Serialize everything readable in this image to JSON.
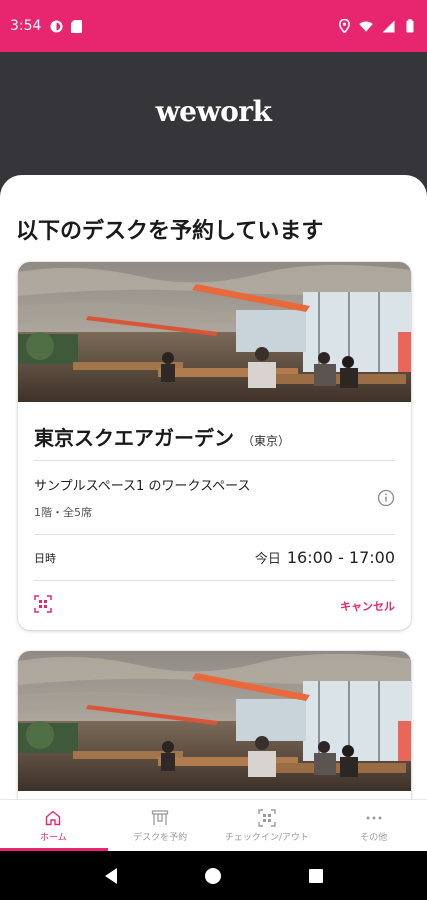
{
  "status_bar": {
    "time": "3:54"
  },
  "header": {
    "logo_text": "wework"
  },
  "main": {
    "section_title": "以下のデスクを予約しています",
    "bookings": [
      {
        "location_name": "東京スクエアガーデン",
        "city": "（東京）",
        "space_name": "サンプルスペース1 のワークスペース",
        "space_detail": "1階・全5席",
        "datetime_label": "日時",
        "day": "今日",
        "time_range": "16:00 - 17:00",
        "cancel_label": "キャンセル"
      },
      {
        "location_name": "",
        "city": ""
      }
    ]
  },
  "bottom_nav": {
    "tabs": [
      {
        "label": "ホーム",
        "icon": "home-icon",
        "active": true
      },
      {
        "label": "デスクを予約",
        "icon": "desk-icon",
        "active": false
      },
      {
        "label": "チェックイン/アウト",
        "icon": "qr-scan-icon",
        "active": false
      },
      {
        "label": "その他",
        "icon": "more-icon",
        "active": false
      }
    ]
  },
  "colors": {
    "accent": "#e8256f",
    "header_bg": "#36363a",
    "sheet_bg": "#ffffff"
  }
}
